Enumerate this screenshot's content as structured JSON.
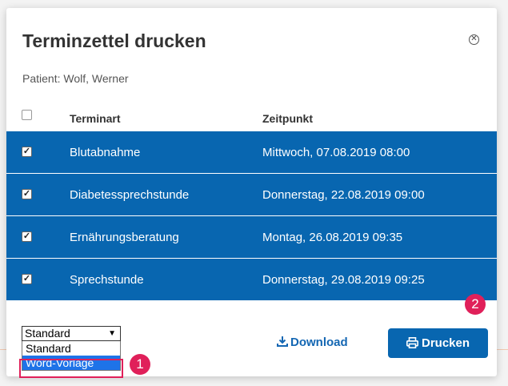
{
  "dialog": {
    "title": "Terminzettel drucken",
    "close_icon": "close-icon",
    "patient": "Patient: Wolf, Werner"
  },
  "table": {
    "headers": {
      "type": "Terminart",
      "time": "Zeitpunkt"
    },
    "rows": [
      {
        "checked": true,
        "type": "Blutabnahme",
        "time": "Mittwoch, 07.08.2019 08:00"
      },
      {
        "checked": true,
        "type": "Diabetessprechstunde",
        "time": "Donnerstag, 22.08.2019 09:00"
      },
      {
        "checked": true,
        "type": "Ernährungsberatung",
        "time": "Montag, 26.08.2019 09:35"
      },
      {
        "checked": true,
        "type": "Sprechstunde",
        "time": "Donnerstag, 29.08.2019 09:25"
      }
    ]
  },
  "template_select": {
    "value": "Standard",
    "options": [
      "Standard",
      "Word-Vorlage"
    ],
    "highlighted": "Word-Vorlage"
  },
  "actions": {
    "download_label": "Download",
    "print_label": "Drucken"
  },
  "annotations": {
    "badge1": "1",
    "badge2": "2"
  },
  "colors": {
    "primary": "#0866b0",
    "accent": "#e0205a",
    "select_highlight": "#1e73e8"
  }
}
